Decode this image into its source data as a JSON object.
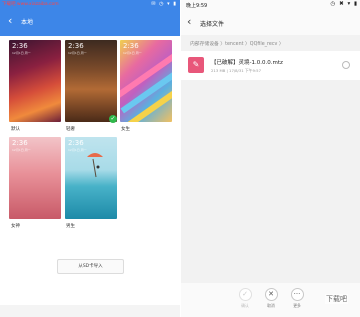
{
  "left": {
    "watermark": "下载吧 www.xiazaiba.com",
    "status_icons": "✉ ◷ ▾ ▮",
    "title": "本地",
    "themes": [
      {
        "label": "默认",
        "clock": "2:36",
        "sub": "12月1日 周一"
      },
      {
        "label": "轻奢",
        "clock": "2:36",
        "sub": "12月1日 周一",
        "selected": true
      },
      {
        "label": "女生",
        "clock": "2:36",
        "sub": "12月1日 周一"
      },
      {
        "label": "女神",
        "clock": "2:36",
        "sub": "12月1日 周一"
      },
      {
        "label": "男生",
        "clock": "2:36",
        "sub": "12月1日 周一"
      }
    ],
    "sd_import": "从SD卡导入"
  },
  "right": {
    "time": "晚上9:59",
    "status_icons": "◷ ✖ ▾ ▮",
    "title": "选择文件",
    "breadcrumb": "内部存储设备 〉tencent 〉QQfile_recv 〉",
    "file": {
      "name": "【已破解】灵境-1.0.0.0.mtz",
      "meta": "213 MB | 17/8/31 下午9:57"
    },
    "toolbar": {
      "confirm": "确认",
      "cancel": "取消",
      "more": "更多"
    },
    "logo": "下载吧"
  },
  "colors": {
    "header_blue": "#3d86e8",
    "check_green": "#2fb84b",
    "file_icon_pink": "#e8577a"
  }
}
